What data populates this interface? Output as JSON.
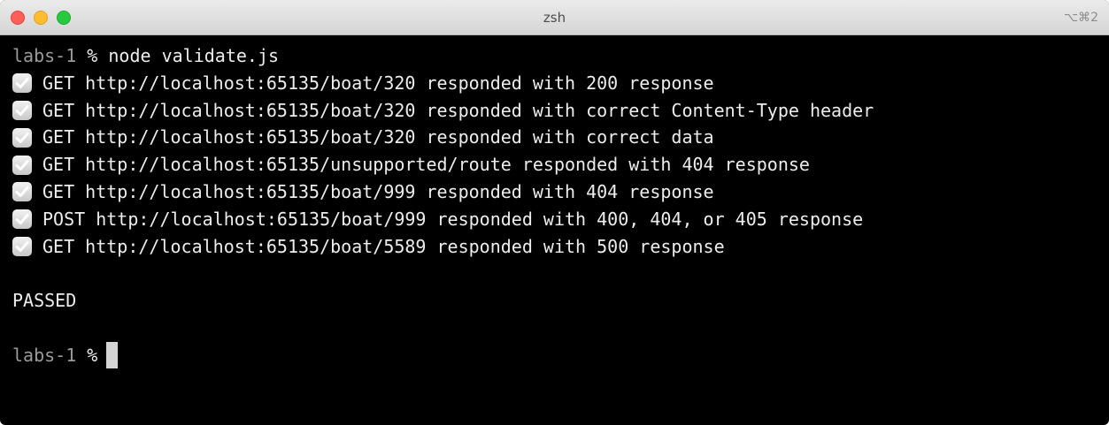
{
  "window": {
    "title": "zsh",
    "shortcut": "⌥⌘2"
  },
  "terminal": {
    "command_line": {
      "host": "labs-1",
      "symbol": "%",
      "command": "node validate.js"
    },
    "results": [
      "GET http://localhost:65135/boat/320 responded with 200 response",
      "GET http://localhost:65135/boat/320 responded with correct Content-Type header",
      "GET http://localhost:65135/boat/320 responded with correct data",
      "GET http://localhost:65135/unsupported/route responded with 404 response",
      "GET http://localhost:65135/boat/999 responded with 404 response",
      "POST http://localhost:65135/boat/999 responded with 400, 404, or 405 response",
      "GET http://localhost:65135/boat/5589 responded with 500 response"
    ],
    "result_icon": "checkmark-icon",
    "status": "PASSED",
    "final_prompt": {
      "host": "labs-1",
      "symbol": "%"
    }
  },
  "colors": {
    "background": "#000000",
    "text": "#ededed",
    "prompt_host": "#9b9b9b",
    "close": "#fe5f57",
    "minimize": "#febc2e",
    "maximize": "#28c840"
  }
}
